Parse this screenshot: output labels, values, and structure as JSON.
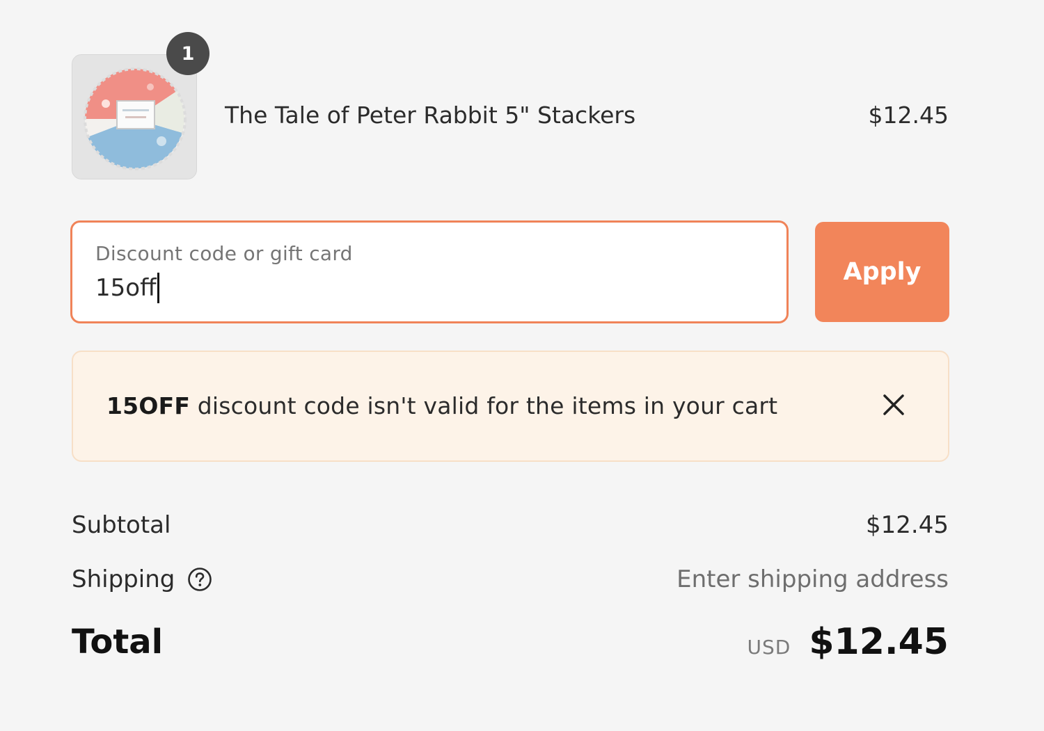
{
  "cart": {
    "item": {
      "quantity": "1",
      "name": "The Tale of Peter Rabbit 5\" Stackers",
      "price": "$12.45",
      "thumbnail_icon": "product-image"
    }
  },
  "discount": {
    "label": "Discount code or gift card",
    "value": "15off",
    "apply_label": "Apply",
    "accent_color": "#f2855a"
  },
  "notice": {
    "code": "15OFF",
    "message": " discount code isn't valid for the items in your cart",
    "close_icon": "close-icon",
    "background_color": "#fdf3e8"
  },
  "summary": {
    "subtotal_label": "Subtotal",
    "subtotal_value": "$12.45",
    "shipping_label": "Shipping",
    "shipping_value": "Enter shipping address",
    "total_label": "Total",
    "currency": "USD",
    "total_value": "$12.45"
  }
}
